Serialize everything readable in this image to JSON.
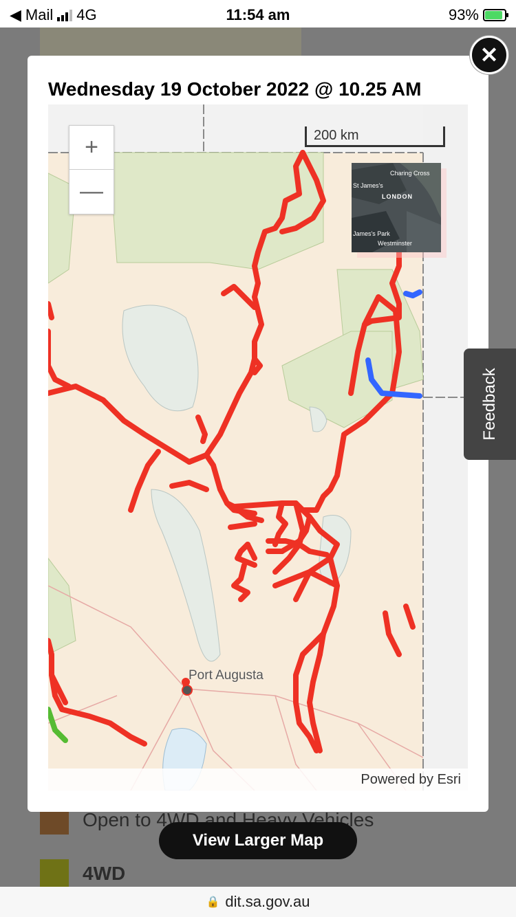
{
  "status_bar": {
    "back_app": "Mail",
    "network": "4G",
    "time": "11:54 am",
    "battery_percent": "93%",
    "battery_level": 0.93,
    "signal_icon": "signal-bars-icon",
    "battery_icon": "battery-charging-icon"
  },
  "background_page": {
    "legend_items": [
      {
        "label": "Open to 4WD and Heavy Vehicles",
        "color": "#6e4a28"
      },
      {
        "label": "4WD",
        "color": "#6f7216"
      }
    ]
  },
  "modal": {
    "title": "Wednesday 19 October 2022 @ 10.25 AM",
    "close_icon": "close-icon"
  },
  "map": {
    "zoom_in_label": "+",
    "zoom_out_label": "—",
    "scale_label": "200 km",
    "place_label": "Port Augusta",
    "attribution": "Powered by Esri",
    "overview_labels": [
      "Charing Cross",
      "St James's",
      "LONDON",
      "James's Park",
      "Westminster"
    ],
    "route_colors": {
      "closed": "#ee3124",
      "open": "#3366ff",
      "other": "#55bb33"
    }
  },
  "feedback_label": "Feedback",
  "view_larger_label": "View Larger Map",
  "url": "dit.sa.gov.au",
  "lock_icon": "lock-icon"
}
